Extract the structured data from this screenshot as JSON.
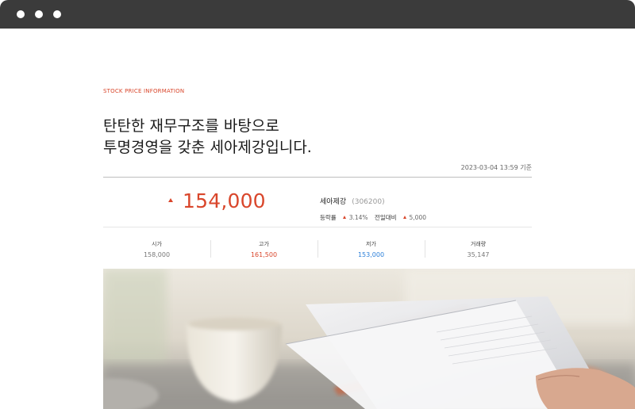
{
  "header": {
    "eyebrow": "STOCK PRICE INFORMATION",
    "headline_line1": "탄탄한 재무구조를 바탕으로",
    "headline_line2": "투명경영을 갖춘 세아제강입니다.",
    "as_of": "2023-03-04 13:59 기준"
  },
  "quote": {
    "price": "154,000",
    "name": "세아제강",
    "code": "(306200)",
    "change_rate_label": "등락률",
    "change_rate_value": "3.14%",
    "change_prev_label": "전일대비",
    "change_prev_value": "5,000"
  },
  "stats": [
    {
      "label": "시가",
      "value": "158,000"
    },
    {
      "label": "고가",
      "value": "161,500"
    },
    {
      "label": "저가",
      "value": "153,000"
    },
    {
      "label": "거래량",
      "value": "35,147"
    }
  ],
  "colors": {
    "up": "#d9462b",
    "down": "#2b7fd9",
    "titlebar": "#3b3b3b"
  }
}
